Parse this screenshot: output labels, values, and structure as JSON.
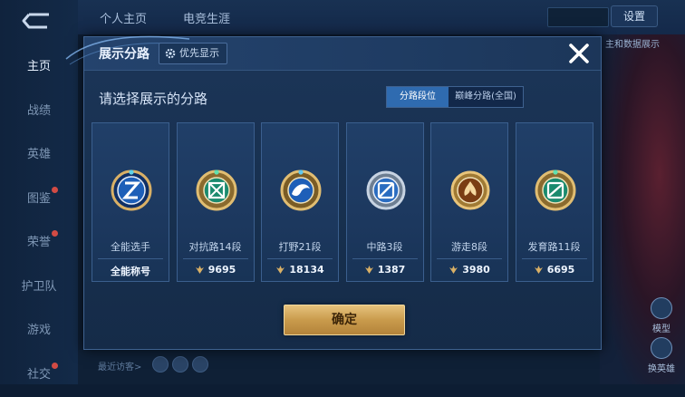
{
  "background": {
    "tabs": [
      "个人主页",
      "电竞生涯"
    ],
    "settings_label": "设置",
    "sidebar_items": [
      {
        "label": "主页",
        "active": true,
        "badge": false
      },
      {
        "label": "战绩",
        "active": false,
        "badge": false
      },
      {
        "label": "英雄",
        "active": false,
        "badge": false
      },
      {
        "label": "图鉴",
        "active": false,
        "badge": true
      },
      {
        "label": "荣誉",
        "active": false,
        "badge": true
      },
      {
        "label": "护卫队",
        "active": false,
        "badge": false
      },
      {
        "label": "游戏",
        "active": false,
        "badge": false
      },
      {
        "label": "社交",
        "active": false,
        "badge": true
      }
    ],
    "right_label": "主和数据展示",
    "right_buttons": [
      "模型",
      "换英雄"
    ],
    "recent_visitors_label": "最近访客>"
  },
  "modal": {
    "title": "展示分路",
    "priority_button": "优先显示",
    "subtitle": "请选择展示的分路",
    "segments": [
      {
        "label": "分路段位",
        "active": true
      },
      {
        "label": "巅峰分路(全国)",
        "active": false
      }
    ],
    "cards": [
      {
        "lane": "全能选手",
        "score": "全能称号",
        "icon": "all-rounder-emblem-icon",
        "show_points_icon": false
      },
      {
        "lane": "对抗路14段",
        "score": "9695",
        "icon": "clash-lane-emblem-icon",
        "show_points_icon": true
      },
      {
        "lane": "打野21段",
        "score": "18134",
        "icon": "jungle-emblem-icon",
        "show_points_icon": true
      },
      {
        "lane": "中路3段",
        "score": "1387",
        "icon": "mid-lane-emblem-icon",
        "show_points_icon": true
      },
      {
        "lane": "游走8段",
        "score": "3980",
        "icon": "roam-emblem-icon",
        "show_points_icon": true
      },
      {
        "lane": "发育路11段",
        "score": "6695",
        "icon": "farm-lane-emblem-icon",
        "show_points_icon": true
      }
    ],
    "confirm_button": "确定"
  },
  "colors": {
    "accent_blue": "#2f6bb0",
    "gold": "#d9b066",
    "modal_bg": "#1c3558"
  }
}
